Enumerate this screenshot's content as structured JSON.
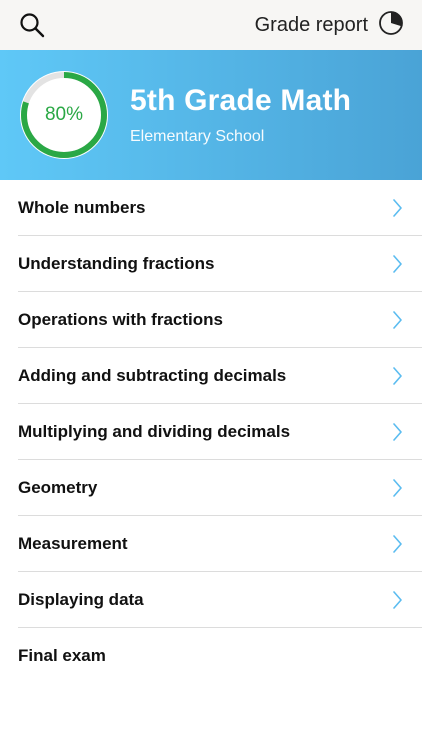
{
  "topbar": {
    "search_icon": "search-icon",
    "grade_report_label": "Grade report",
    "grade_report_icon": "pie-chart-icon"
  },
  "course": {
    "progress_label": "80%",
    "progress": 0.8,
    "title": "5th Grade Math",
    "subtitle": "Elementary School"
  },
  "colors": {
    "accent_blue": "#4aa3d6",
    "progress_green": "#2aa845",
    "chevron": "#5bbcf0"
  },
  "topics": [
    {
      "label": "Whole numbers",
      "chevron": true
    },
    {
      "label": "Understanding fractions",
      "chevron": true
    },
    {
      "label": "Operations with fractions",
      "chevron": true
    },
    {
      "label": "Adding and subtracting decimals",
      "chevron": true
    },
    {
      "label": "Multiplying and dividing decimals",
      "chevron": true
    },
    {
      "label": "Geometry",
      "chevron": true
    },
    {
      "label": "Measurement",
      "chevron": true
    },
    {
      "label": "Displaying data",
      "chevron": true
    },
    {
      "label": "Final exam",
      "chevron": false
    }
  ]
}
